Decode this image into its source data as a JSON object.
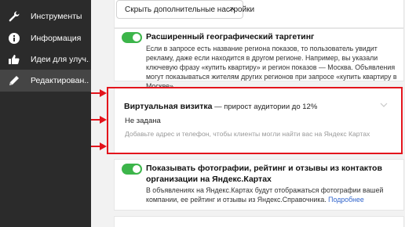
{
  "sidebar": {
    "items": [
      {
        "label": "Инструменты",
        "icon": "wrench-icon"
      },
      {
        "label": "Информация",
        "icon": "info-icon"
      },
      {
        "label": "Идеи для улуч...",
        "icon": "thumbs-up-icon"
      },
      {
        "label": "Редактирован...",
        "icon": "pencil-icon",
        "active": true
      }
    ]
  },
  "settings": {
    "hide_button_label": "Скрыть дополнительные настройки",
    "geo_targeting": {
      "title": "Расширенный географический таргетинг",
      "description": "Если в запросе есть название региона показов, то пользователь увидит рекламу, даже если находится в другом регионе. Например, вы указали ключевую фразу «купить квартиру» и регион показов — Москва. Объявления могут показываться жителям других регионов при запросе «купить квартиру в Москве».",
      "enabled": true
    },
    "virtual_card": {
      "title": "Виртуальная визитка",
      "subtitle": "— прирост аудитории до 12%",
      "value": "Не задана",
      "hint": "Добавьте адрес и телефон, чтобы клиенты могли найти вас на Яндекс Картах"
    },
    "maps_photos": {
      "title": "Показывать фотографии, рейтинг и отзывы из контактов организации на Яндекс.Картах",
      "description": "В объявлениях на Яндекс.Картах будут отображаться фотографии вашей компании, ее рейтинг и отзывы из Яндекс.Справочника.",
      "link": "Подробнее",
      "enabled": true
    }
  },
  "colors": {
    "sidebar_bg": "#2b2b2b",
    "toggle_on": "#3cb54a",
    "highlight": "#e3141c",
    "link": "#3366cc"
  }
}
